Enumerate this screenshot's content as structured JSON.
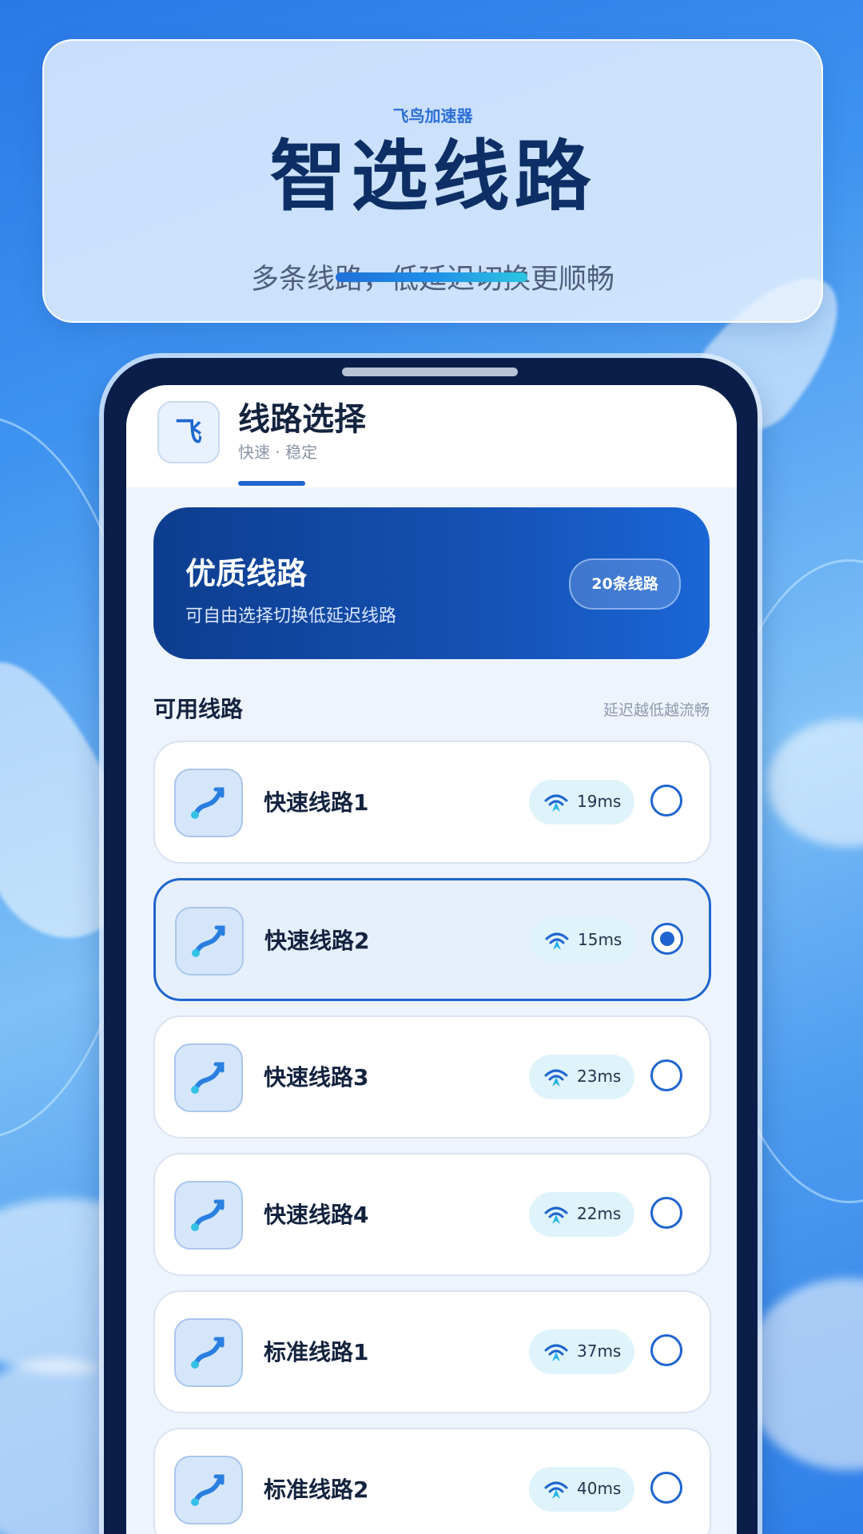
{
  "hero": {
    "brand": "飞鸟加速器",
    "title": "智选线路",
    "subtitle": "多条线路，低延迟切换更顺畅"
  },
  "app": {
    "logo_glyph": "飞",
    "title": "线路选择",
    "subtitle": "快速 · 稳定"
  },
  "promo": {
    "title": "优质线路",
    "subtitle": "可自由选择切换低延迟线路",
    "badge": "20条线路"
  },
  "section": {
    "title": "可用线路",
    "hint": "延迟越低越流畅"
  },
  "routes": [
    {
      "name": "快速线路1",
      "latency": "19ms",
      "selected": false
    },
    {
      "name": "快速线路2",
      "latency": "15ms",
      "selected": true
    },
    {
      "name": "快速线路3",
      "latency": "23ms",
      "selected": false
    },
    {
      "name": "快速线路4",
      "latency": "22ms",
      "selected": false
    },
    {
      "name": "标准线路1",
      "latency": "37ms",
      "selected": false
    },
    {
      "name": "标准线路2",
      "latency": "40ms",
      "selected": false
    }
  ],
  "colors": {
    "accent": "#1f65cf",
    "title_dark": "#13233f",
    "promo_dark": "#0d3d8e"
  },
  "icons": {
    "route": "route-path-icon",
    "latency": "signal-wifi-icon"
  }
}
